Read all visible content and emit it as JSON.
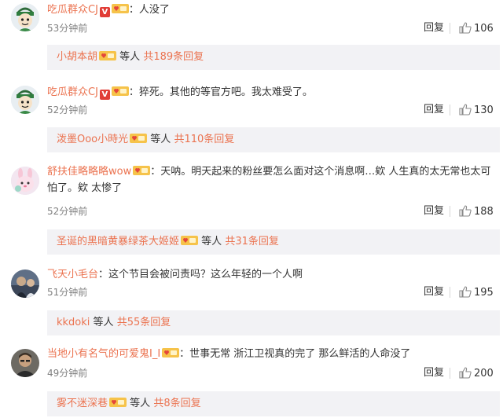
{
  "comments": [
    {
      "username": "吃瓜群众CJ",
      "text": "：人没了",
      "time": "53分钟前",
      "reply_label": "回复",
      "likes": "106",
      "sub_user": "小胡本胡",
      "sub_suffix": "等人",
      "sub_total": "共189条回复",
      "avatar_icon": "cartoon-boy-avatar-icon",
      "has_v_badge": true
    },
    {
      "username": "吃瓜群众CJ",
      "text": "：猝死。其他的等官方吧。我太难受了。",
      "time": "52分钟前",
      "reply_label": "回复",
      "likes": "130",
      "sub_user": "泼墨Ooo小時光",
      "sub_suffix": "等人",
      "sub_total": "共110条回复",
      "avatar_icon": "cartoon-boy-avatar-icon",
      "has_v_badge": true
    },
    {
      "username": "舒扶佳略略略wow",
      "text": "：天呐。明天起来的粉丝要怎么面对这个消息啊…欸 人生真的太无常也太可怕了。欸 太惨了",
      "time": "52分钟前",
      "reply_label": "回复",
      "likes": "188",
      "sub_user": "圣诞的黑暗黄暴绿茶大姬姬",
      "sub_suffix": "等人",
      "sub_total": "共31条回复",
      "avatar_icon": "cartoon-bunny-avatar-icon",
      "has_v_badge": false
    },
    {
      "username": "飞天小毛台",
      "text": "：这个节目会被问责吗？这么年轻的一个人啊",
      "time": "51分钟前",
      "reply_label": "回复",
      "likes": "195",
      "sub_user": "kkdoki",
      "sub_suffix": "等人",
      "sub_total": "共55条回复",
      "avatar_icon": "photo-avatar-icon",
      "has_v_badge": false
    },
    {
      "username": "当地小有名气的可爱鬼I_I",
      "text": "：世事无常 浙江卫视真的完了 那么鲜活的人命没了",
      "time": "49分钟前",
      "reply_label": "回复",
      "likes": "200",
      "sub_user": "雾不迷深巷",
      "sub_suffix": "等人",
      "sub_total": "共8条回复",
      "avatar_icon": "man-portrait-avatar-icon",
      "has_v_badge": false
    }
  ],
  "colors": {
    "username": "#eb7350",
    "badge_v": "#e13d36",
    "sub_bg": "#f2f2f5",
    "time": "#808080"
  },
  "badges": {
    "v_label": "V"
  }
}
